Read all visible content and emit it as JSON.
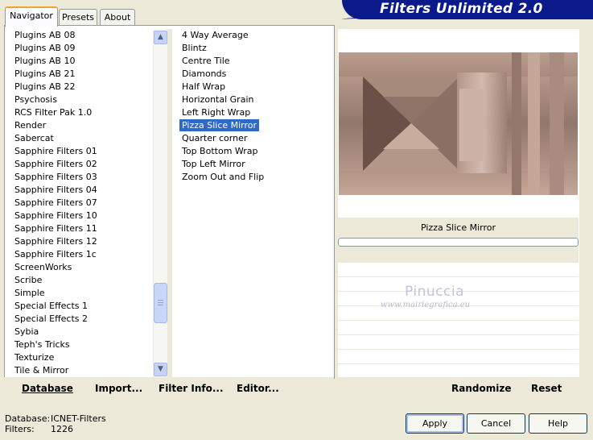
{
  "header": {
    "title": "Filters Unlimited 2.0"
  },
  "tabs": [
    {
      "label": "Navigator",
      "active": true
    },
    {
      "label": "Presets",
      "active": false
    },
    {
      "label": "About",
      "active": false
    }
  ],
  "categories": [
    "Plugins AB 08",
    "Plugins AB 09",
    "Plugins AB 10",
    "Plugins AB 21",
    "Plugins AB 22",
    "Psychosis",
    "RCS Filter Pak 1.0",
    "Render",
    "Sabercat",
    "Sapphire Filters 01",
    "Sapphire Filters 02",
    "Sapphire Filters 03",
    "Sapphire Filters 04",
    "Sapphire Filters 07",
    "Sapphire Filters 10",
    "Sapphire Filters 11",
    "Sapphire Filters 12",
    "Sapphire Filters 1c",
    "ScreenWorks",
    "Scribe",
    "Simple",
    "Special Effects 1",
    "Special Effects 2",
    "Sybia",
    "Teph's Tricks",
    "Texturize",
    "Tile & Mirror"
  ],
  "selected_category": "Simple",
  "filters": [
    "4 Way Average",
    "Blintz",
    "Centre Tile",
    "Diamonds",
    "Half Wrap",
    "Horizontal Grain",
    "Left Right Wrap",
    "Pizza Slice Mirror",
    "Quarter corner",
    "Top Bottom Wrap",
    "Top Left Mirror",
    "Zoom Out and Flip"
  ],
  "selected_filter": "Pizza Slice Mirror",
  "preview": {
    "caption": "Pizza Slice Mirror",
    "progress": 0
  },
  "watermark": {
    "name": "Pinuccia",
    "site": "www.mairiegrafica.eu"
  },
  "toolbar": {
    "database": "Database",
    "import": "Import...",
    "filter_info": "Filter Info...",
    "editor": "Editor...",
    "randomize": "Randomize",
    "reset": "Reset"
  },
  "status": {
    "database_label": "Database:",
    "database_value": "ICNET-Filters",
    "filters_label": "Filters:",
    "filters_value": "1226"
  },
  "buttons": {
    "apply": "Apply",
    "cancel": "Cancel",
    "help": "Help"
  },
  "colors": {
    "accent": "#316ac5",
    "banner": "#0a1a8a",
    "tab_highlight": "#f1a130"
  }
}
